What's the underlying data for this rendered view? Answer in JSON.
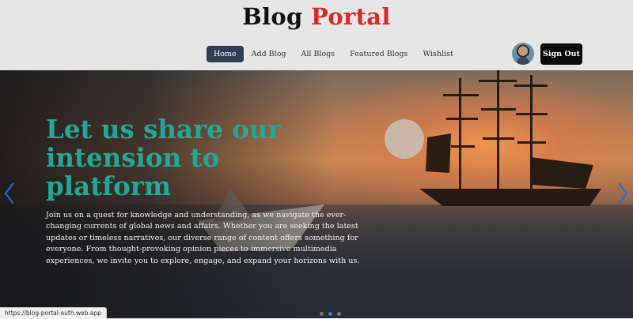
{
  "brand": {
    "part1": "Blog",
    "part2": "Portal"
  },
  "nav": {
    "items": [
      {
        "label": "Home",
        "active": true
      },
      {
        "label": "Add Blog"
      },
      {
        "label": "All Blogs"
      },
      {
        "label": "Featured Blogs"
      },
      {
        "label": "Wishlist"
      }
    ]
  },
  "user": {
    "signout_label": "Sign Out"
  },
  "hero": {
    "title": "Let us share our intension to platform",
    "body": "Join us on a quest for knowledge and understanding, as we navigate the ever-changing currents of global news and affairs. Whether you are seeking the latest updates or timeless narratives, our diverse range of content offers something for everyone. From thought-provoking opinion pieces to immersive multimedia experiences, we invite you to explore, engage, and expand your horizons with us."
  },
  "carousel": {
    "slide_count": 3,
    "active_index": 1
  },
  "status": {
    "url": "https://blog-portal-auth.web.app"
  },
  "colors": {
    "accent": "#20a898",
    "brand_red": "#d42a2a",
    "nav_active": "#2f3e55",
    "arrow": "#1e6fd9"
  }
}
